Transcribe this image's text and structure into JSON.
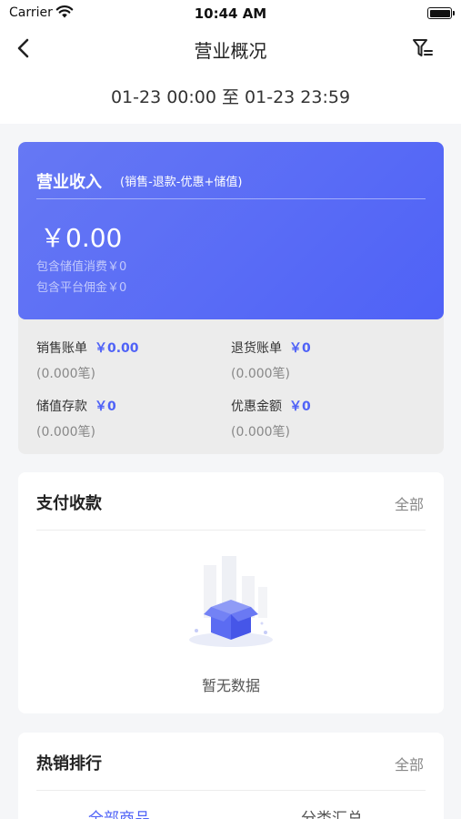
{
  "status_bar": {
    "carrier": "Carrier",
    "time": "10:44 AM",
    "wifi_icon": "wifi-icon",
    "battery_icon": "battery-icon"
  },
  "nav": {
    "title": "营业概况",
    "back_icon": "chevron-left-icon",
    "filter_icon": "filter-icon"
  },
  "date_range": "01-23 00:00 至 01-23 23:59",
  "revenue": {
    "title": "营业收入",
    "formula": "(销售-退款-优惠+储值)",
    "amount": "￥0.00",
    "sub1": "包含储值消费￥0",
    "sub2": "包含平台佣金￥0"
  },
  "stats": [
    {
      "label": "销售账单",
      "value": "￥0.00",
      "count": "(0.000笔)"
    },
    {
      "label": "退货账单",
      "value": "￥0",
      "count": "(0.000笔)"
    },
    {
      "label": "储值存款",
      "value": "￥0",
      "count": "(0.000笔)"
    },
    {
      "label": "优惠金额",
      "value": "￥0",
      "count": "(0.000笔)"
    }
  ],
  "payment": {
    "title": "支付收款",
    "link": "全部",
    "empty_text": "暂无数据",
    "empty_icon": "empty-box-icon"
  },
  "hot_sales": {
    "title": "热销排行",
    "link": "全部",
    "tabs": [
      "全部商品",
      "分类汇总"
    ]
  },
  "colors": {
    "accent": "#4f62f7",
    "card_gradient_start": "#6678f4",
    "background": "#f5f6f8"
  }
}
